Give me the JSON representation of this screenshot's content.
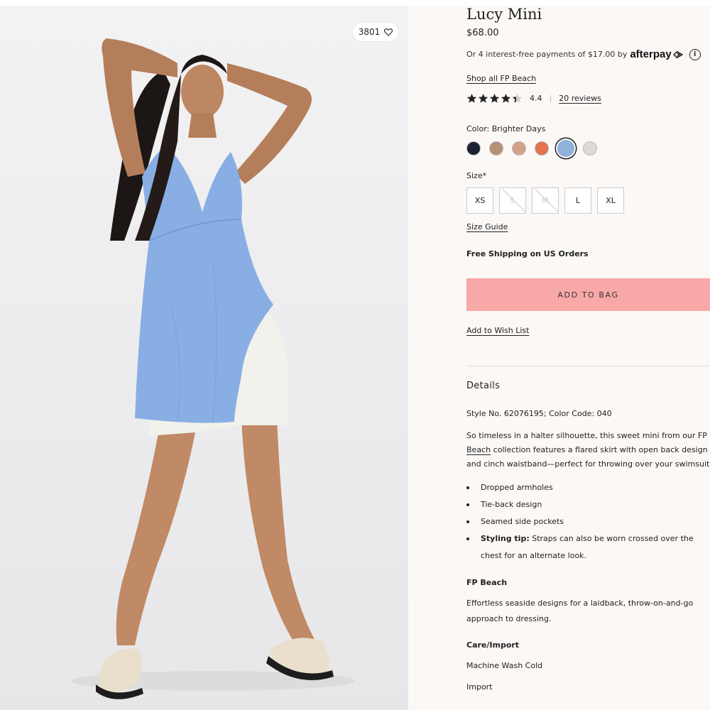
{
  "product": {
    "title": "Lucy Mini",
    "price": "$68.00",
    "favorites_count": "3801",
    "afterpay_text": "Or 4 interest-free payments of $17.00 by",
    "afterpay_brand": "afterpay",
    "info_symbol": "i",
    "shop_all": "Shop all FP Beach",
    "rating_value": "4.4",
    "rating_fraction": 0.88,
    "rating_separator": "|",
    "reviews_link": "20 reviews",
    "color_label": "Color: Brighter Days",
    "colors": [
      {
        "hex": "#1d2230",
        "selected": false
      },
      {
        "hex": "#b58f76",
        "selected": false
      },
      {
        "hex": "#d4a08a",
        "selected": false
      },
      {
        "hex": "#e5714f",
        "selected": false
      },
      {
        "hex": "#8fb1dc",
        "selected": true
      },
      {
        "hex": "#dedad8",
        "selected": false
      }
    ],
    "size_label": "Size*",
    "sizes": [
      {
        "label": "XS",
        "available": true
      },
      {
        "label": "S",
        "available": false
      },
      {
        "label": "M",
        "available": false
      },
      {
        "label": "L",
        "available": true
      },
      {
        "label": "XL",
        "available": true
      }
    ],
    "size_guide": "Size Guide",
    "shipping": "Free Shipping on US Orders",
    "add_to_bag": "ADD TO BAG",
    "wish_list": "Add to Wish List"
  },
  "details": {
    "heading": "Details",
    "style_no": "Style No. 62076195; Color Code: 040",
    "desc_line1": "So timeless in a halter silhouette, this sweet mini from our FP",
    "desc_link": "Beach",
    "desc_line2_rest": " collection features a flared skirt with open back design",
    "desc_line3": "and cinch waistband—perfect for throwing over your swimsuit.",
    "bullets": [
      "Dropped armholes",
      "Tie-back design",
      "Seamed side pockets"
    ],
    "tip_label": "Styling tip:",
    "tip_text": " Straps can also be worn crossed over the",
    "tip_cont": "chest for an alternate look.",
    "fp_heading": "FP Beach",
    "fp_line1": "Effortless seaside designs for a laidback, throw-on-and-go",
    "fp_line2": "approach to dressing.",
    "care_heading": "Care/Import",
    "care_1": "Machine Wash Cold",
    "care_2": "Import"
  },
  "colors": {
    "accent": "#f9a8a8",
    "background": "#fbf8f6"
  }
}
